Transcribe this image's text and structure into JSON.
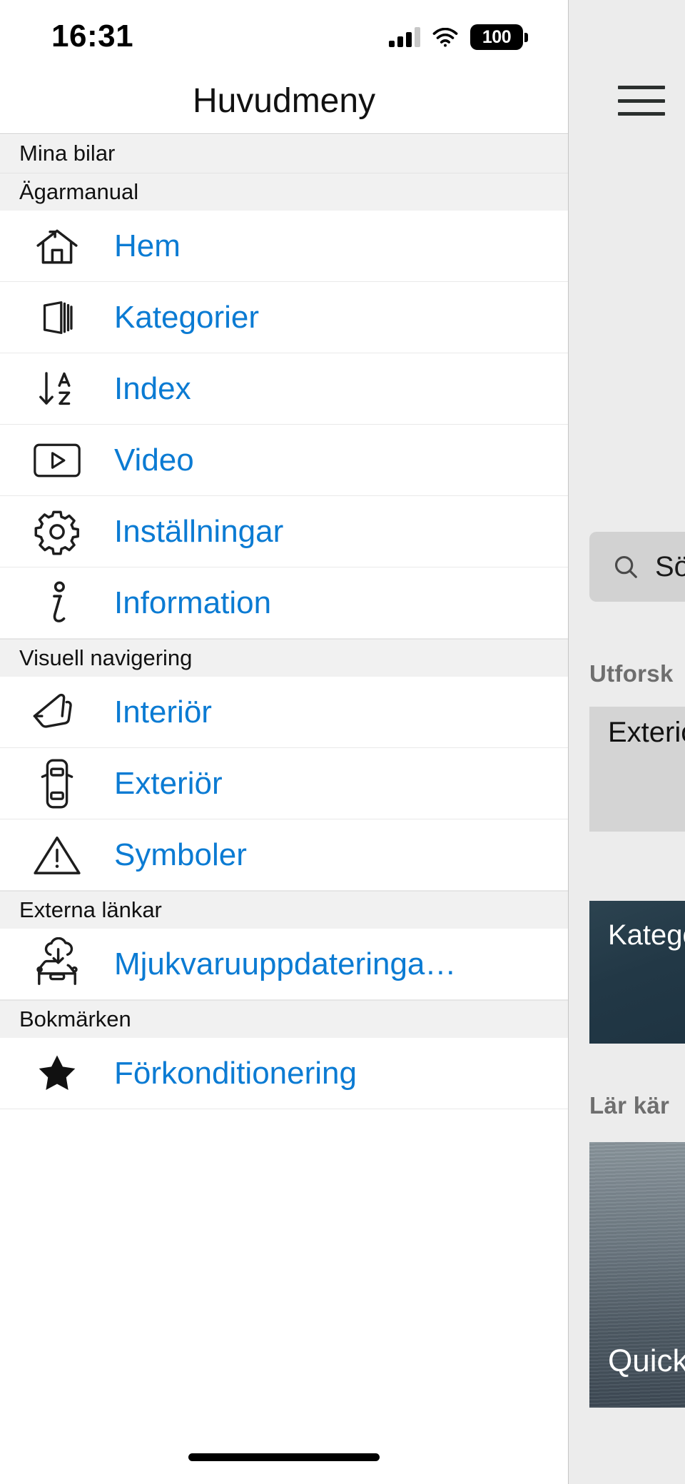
{
  "status_bar": {
    "time": "16:31",
    "battery_level": "100",
    "cellular_icon": "cellular-signal-icon",
    "wifi_icon": "wifi-icon",
    "battery_icon": "battery-icon"
  },
  "drawer": {
    "title": "Huvudmeny",
    "sections": [
      {
        "header": "Mina bilar",
        "items": []
      },
      {
        "header": "Ägarmanual",
        "items": [
          {
            "icon": "home-icon",
            "label": "Hem"
          },
          {
            "icon": "book-icon",
            "label": "Kategorier"
          },
          {
            "icon": "sort-az-icon",
            "label": "Index"
          },
          {
            "icon": "video-icon",
            "label": "Video"
          },
          {
            "icon": "gear-icon",
            "label": "Inställningar"
          },
          {
            "icon": "info-icon",
            "label": "Information"
          }
        ]
      },
      {
        "header": "Visuell navigering",
        "items": [
          {
            "icon": "car-seat-icon",
            "label": "Interiör"
          },
          {
            "icon": "car-top-view-icon",
            "label": "Exteriör"
          },
          {
            "icon": "warning-triangle-icon",
            "label": "Symboler"
          }
        ]
      },
      {
        "header": "Externa länkar",
        "items": [
          {
            "icon": "software-update-icon",
            "label": "Mjukvaruuppdateringa…"
          }
        ]
      },
      {
        "header": "Bokmärken",
        "items": [
          {
            "icon": "star-icon",
            "label": "Förkonditionering"
          }
        ]
      }
    ]
  },
  "background": {
    "menu_button_icon": "hamburger-menu-icon",
    "search": {
      "icon": "search-icon",
      "placeholder": "Sö"
    },
    "explore_heading": "Utforsk",
    "card_exterior": "Exteriö",
    "card_categories": "Katego",
    "learn_heading": "Lär kär",
    "card_quick": "Quick"
  },
  "colors": {
    "link_blue": "#0b7bd3",
    "section_bg": "#f1f1f1",
    "page_bg": "#ececec",
    "card_dark": "#223846"
  }
}
